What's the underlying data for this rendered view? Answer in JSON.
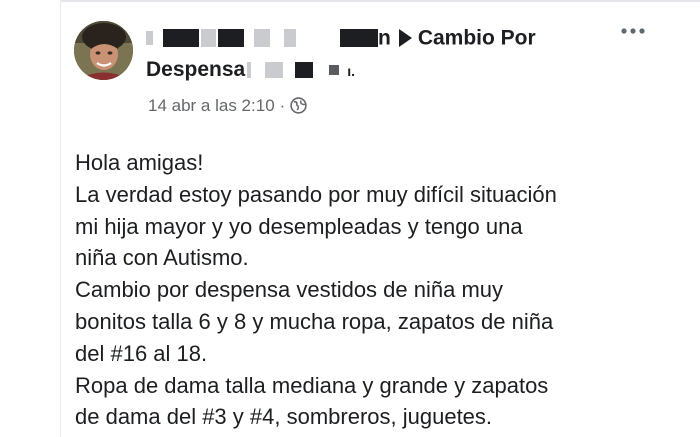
{
  "post": {
    "author_partial": "n",
    "group_name": "Cambio Por",
    "group_name_cont": "Despensa",
    "group_suffix_partial": "ı.",
    "timestamp": "14 abr a las 2:10",
    "dot": "·",
    "privacy_icon": "globe-icon",
    "more_icon": "more-options-icon",
    "body_lines": [
      "Hola amigas!",
      "La verdad estoy pasando por muy difícil situación",
      "mi hija mayor y yo desempleadas y tengo una",
      "niña con Autismo.",
      "Cambio por despensa vestidos de niña muy",
      "bonitos talla 6 y 8 y mucha ropa, zapatos de niña",
      "del #16 al 18.",
      "Ropa de dama talla mediana y grande y zapatos",
      "de dama del #3 y #4, sombreros, juguetes."
    ]
  },
  "colors": {
    "text_primary": "#1c1e21",
    "text_secondary": "#65676b",
    "redaction": "#1c1e21"
  }
}
